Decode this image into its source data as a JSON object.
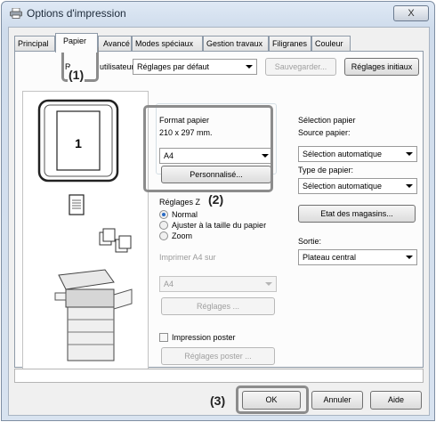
{
  "window": {
    "title": "Options d'impression",
    "close_glyph": "X"
  },
  "tabs": [
    {
      "label": "Principal"
    },
    {
      "label": "Papier"
    },
    {
      "label": "Avancé"
    },
    {
      "label": "Modes spéciaux"
    },
    {
      "label": "Gestion travaux"
    },
    {
      "label": "Filigranes"
    },
    {
      "label": "Couleur"
    }
  ],
  "user_settings": {
    "label_left": "R",
    "label_right": "utilisateur:",
    "value": "Réglages par défaut",
    "save_label": "Sauvegarder...",
    "initial_label": "Réglages initiaux"
  },
  "paper_format": {
    "title": "Format papier",
    "dimensions": "210 x 297 mm.",
    "value": "A4",
    "custom_label": "Personnalisé..."
  },
  "zoom": {
    "title": "Réglages Z",
    "options": [
      "Normal",
      "Ajuster à la taille du papier",
      "Zoom"
    ],
    "selected": "Normal",
    "print_on_label": "Imprimer A4 sur",
    "print_on_value": "A4",
    "settings_label": "Réglages ..."
  },
  "poster": {
    "label": "Impression poster",
    "settings_label": "Réglages poster ..."
  },
  "paper_selection": {
    "title": "Sélection papier",
    "source_label": "Source papier:",
    "source_value": "Sélection automatique",
    "type_label": "Type de papier:",
    "type_value": "Sélection automatique",
    "trays_label": "Etat des magasins..."
  },
  "output": {
    "label": "Sortie:",
    "value": "Plateau central"
  },
  "preview": {
    "page_number": "1"
  },
  "callouts": {
    "c1": "(1)",
    "c2": "(2)",
    "c3": "(3)"
  },
  "footer": {
    "ok_label": "OK",
    "cancel_label": "Annuler",
    "help_label": "Aide"
  },
  "icons": [
    "printer-icon",
    "document-icon",
    "staple-pages-icon",
    "copier-machine-icon",
    "close-icon"
  ]
}
